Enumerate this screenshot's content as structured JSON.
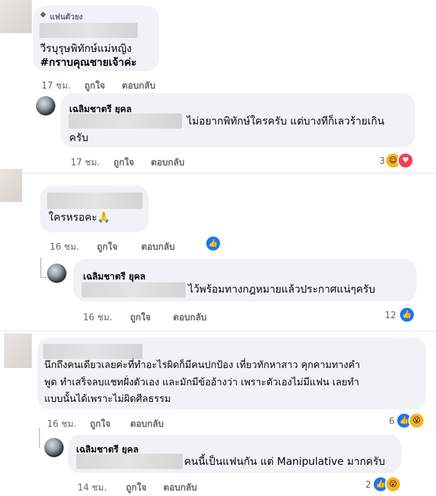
{
  "top_fan_badge": "แฟนตัวยง",
  "comments": [
    {
      "text_line1": "วีรบุรุษพิทักษ์แม่หญิง",
      "text_line2": "#กราบคุณชายเจ้าค่ะ",
      "time": "17 ชม.",
      "like_label": "ถูกใจ",
      "reply_label": "ตอบกลับ"
    },
    {
      "author": "เฉลิมชาตรี ยุคล",
      "text_line1": "ไม่อยากพิทักษ์ใครครับ แต่บางทีก็เลวร้ายเกิน",
      "text_line2": "ครับ",
      "time": "17 ชม.",
      "like_label": "ถูกใจ",
      "reply_label": "ตอบกลับ",
      "reaction_count": "3"
    },
    {
      "text_line1": "ใครหรอคะ🙏",
      "time": "16 ชม.",
      "like_label": "ถูกใจ",
      "reply_label": "ตอบกลับ"
    },
    {
      "author": "เฉลิมชาตรี ยุคล",
      "text_line1": "ไว้พร้อมทางกฎหมายแล้วประกาศแน่ๆครับ",
      "time": "16 ชม.",
      "like_label": "ถูกใจ",
      "reply_label": "ตอบกลับ",
      "reaction_count": "12"
    },
    {
      "text_line1": "นึกถึงคนเดียวเลยค่ะที่ทำอะไรผิดก็มีคนปกป้อง เที่ยวทักหาสาว คุกคามทางคำ",
      "text_line2": "พูด ทำเสร็จลบแชทฝั่งตัวเอง และมักมีข้ออ้างว่า เพราะตัวเองไม่มีแฟน เลยทำ",
      "text_line3": "แบบนั้นได้เพราะไม่ผิดศีลธรรม",
      "time": "16 ชม.",
      "like_label": "ถูกใจ",
      "reply_label": "ตอบกลับ",
      "reaction_count": "6"
    },
    {
      "author": "เฉลิมชาตรี ยุคล",
      "text_line1": "คนนี้เป็นแฟนกัน แต่ Manipulative มากครับ",
      "time": "14 ชม.",
      "like_label": "ถูกใจ",
      "reply_label": "ตอบกลับ",
      "reaction_count": "2"
    }
  ],
  "colors": {
    "like_blue": "#1877f2",
    "bubble_bg": "#f0f2f5",
    "meta_gray": "#65676b"
  },
  "icons": [
    "diamond-icon",
    "like-icon",
    "care-icon",
    "love-icon",
    "wow-icon"
  ]
}
